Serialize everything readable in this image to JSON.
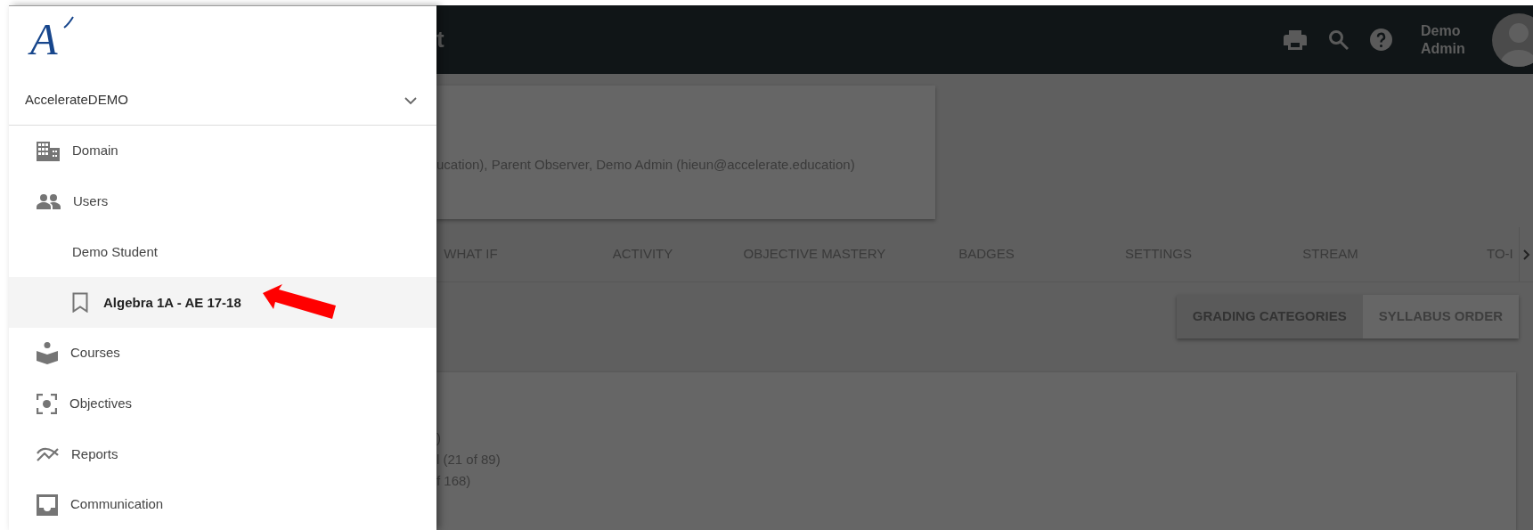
{
  "drawer": {
    "logo": "A",
    "organization": {
      "name": "AccelerateDEMO",
      "expanded": false
    },
    "items": [
      {
        "label": "Domain",
        "selected": false
      },
      {
        "label": "Users",
        "selected": false,
        "children": [
          {
            "label": "Demo Student",
            "selected": false,
            "children": [
              {
                "label": "Algebra 1A - AE 17-18",
                "selected": true
              }
            ]
          }
        ]
      },
      {
        "label": "Courses",
        "selected": false
      },
      {
        "label": "Objectives",
        "selected": false
      },
      {
        "label": "Reports",
        "selected": false
      },
      {
        "label": "Communication",
        "selected": false
      }
    ]
  },
  "header": {
    "title": "t",
    "user_name": "Demo Admin"
  },
  "info_card": {
    "text": "ucation), Parent Observer, Demo Admin (hieun@accelerate.education)"
  },
  "tabs": [
    {
      "label": "WHAT IF",
      "selected": false
    },
    {
      "label": "ACTIVITY",
      "selected": false
    },
    {
      "label": "OBJECTIVE MASTERY",
      "selected": false
    },
    {
      "label": "BADGES",
      "selected": false
    },
    {
      "label": "SETTINGS",
      "selected": false
    },
    {
      "label": "STREAM",
      "selected": false
    },
    {
      "label": "TO-I",
      "selected": false
    }
  ],
  "view_toggle": [
    {
      "label": "GRADING CATEGORIES",
      "selected": true
    },
    {
      "label": "SYLLABUS ORDER",
      "selected": false
    }
  ],
  "content_lines": [
    ")",
    "l (21 of 89)",
    "f 168)"
  ]
}
